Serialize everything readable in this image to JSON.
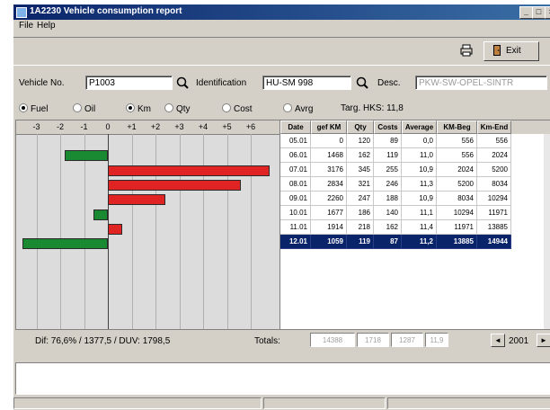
{
  "window": {
    "title": "1A2230 Vehicle consumption report",
    "controls": {
      "minimize": "_",
      "maximize": "□",
      "close": "×"
    }
  },
  "menu": {
    "file": "File",
    "help": "Help"
  },
  "toolbar": {
    "printer_icon": "printer-icon",
    "exit_label": "Exit",
    "exit_icon": "door-exit-icon"
  },
  "fields": {
    "vehicle_label": "Vehicle No.",
    "vehicle_value": "P1003",
    "identification_label": "Identification",
    "identification_value": "HU-SM 998",
    "desc_label": "Desc.",
    "desc_value": "PKW-SW-OPEL-SINTR"
  },
  "options": {
    "fuel": "Fuel",
    "oil": "Oil",
    "km": "Km",
    "qty": "Qty",
    "cost": "Cost",
    "avrg": "Avrg",
    "selected": [
      "fuel",
      "km"
    ],
    "targ": "Targ. HKS: 11,8"
  },
  "chart_data": {
    "type": "bar",
    "orientation": "horizontal",
    "ticks": [
      "-3",
      "-2",
      "-1",
      "0",
      "+1",
      "+2",
      "+3",
      "+4",
      "+5",
      "+6"
    ],
    "xlim": [
      -3.6,
      6.6
    ],
    "categories": [
      "05.01",
      "06.01",
      "07.01",
      "08.01",
      "09.01",
      "10.01",
      "11.01",
      "12.01"
    ],
    "values": [
      0,
      -1.8,
      6.8,
      5.6,
      2.4,
      -0.6,
      0.6,
      -3.6
    ],
    "colors": {
      "positive": "#e02424",
      "negative": "#1a8a32"
    },
    "grid": true
  },
  "table": {
    "columns": [
      "Date",
      "gef KM",
      "Qty",
      "Costs",
      "Average",
      "KM-Beg",
      "Km-End"
    ],
    "rows": [
      [
        "05.01",
        "0",
        "120",
        "89",
        "0,0",
        "556",
        "556"
      ],
      [
        "06.01",
        "1468",
        "162",
        "119",
        "11,0",
        "556",
        "2024"
      ],
      [
        "07.01",
        "3176",
        "345",
        "255",
        "10,9",
        "2024",
        "5200"
      ],
      [
        "08.01",
        "2834",
        "321",
        "246",
        "11,3",
        "5200",
        "8034"
      ],
      [
        "09.01",
        "2260",
        "247",
        "188",
        "10,9",
        "8034",
        "10294"
      ],
      [
        "10.01",
        "1677",
        "186",
        "140",
        "11,1",
        "10294",
        "11971"
      ],
      [
        "11.01",
        "1914",
        "218",
        "162",
        "11,4",
        "11971",
        "13885"
      ],
      [
        "12.01",
        "1059",
        "119",
        "87",
        "11,2",
        "13885",
        "14944"
      ]
    ],
    "selected_index": 7
  },
  "status": {
    "diff": "Dif: 76,6% / 1377,5 / DUV: 1798,5",
    "totals_label": "Totals:",
    "totals": [
      "14388",
      "1718",
      "1287",
      "11,9"
    ],
    "year": "2001",
    "prev": "◄",
    "next": "►"
  }
}
